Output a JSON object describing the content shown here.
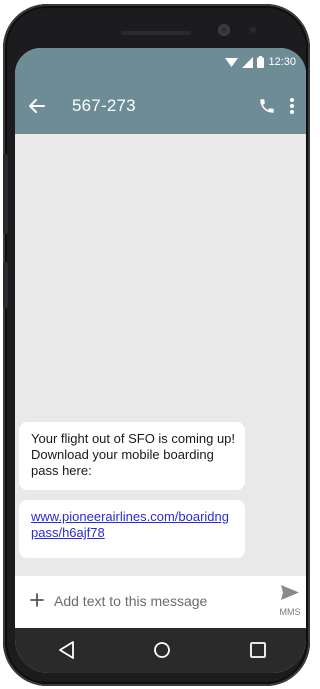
{
  "status_bar": {
    "time": "12:30"
  },
  "app_bar": {
    "title": "567-273"
  },
  "messages": [
    {
      "text": "Your flight out of SFO is coming up! Download your mobile boarding pass here:"
    },
    {
      "link": "www.pioneerairlines.com/boaridngpass/h6ajf78"
    }
  ],
  "composer": {
    "placeholder": "Add text to this message",
    "send_label": "MMS"
  },
  "colors": {
    "app_bar": "#6e8c95",
    "background": "#e9e9e9",
    "link": "#2b2bd6",
    "nav_bar": "#2a2a2a"
  },
  "icons": [
    "back-arrow-icon",
    "phone-icon",
    "more-vert-icon",
    "add-icon",
    "send-icon",
    "nav-back-icon",
    "nav-home-icon",
    "nav-recent-icon",
    "wifi-icon",
    "signal-icon",
    "battery-icon"
  ]
}
